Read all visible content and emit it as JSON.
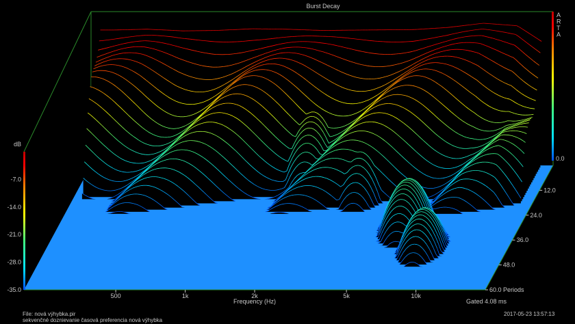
{
  "chart_data": {
    "type": "waterfall-3d",
    "title": "Burst Decay",
    "brand": "ARTA",
    "xlabel": "Frequency (Hz)",
    "x_scale": "log",
    "x_ticks": [
      {
        "value": 500,
        "label": "500"
      },
      {
        "value": 1000,
        "label": "1k"
      },
      {
        "value": 2000,
        "label": "2k"
      },
      {
        "value": 5000,
        "label": "5k"
      },
      {
        "value": 10000,
        "label": "10k"
      }
    ],
    "xlim": [
      200,
      20000
    ],
    "zlabel": "dB",
    "z_ticks": [
      "0.0",
      "-7.0",
      "-14.0",
      "-21.0",
      "-28.0",
      "-35.0"
    ],
    "zlim": [
      -35,
      0
    ],
    "y_ticks": [
      "12.0",
      "24.0",
      "36.0",
      "48.0",
      "60.0 Periods"
    ],
    "ylim": [
      0,
      60
    ],
    "y_unit": "Periods",
    "gated": "Gated 4.08 ms",
    "colormap": [
      "#0050ff",
      "#00e0ff",
      "#40ff80",
      "#ffff00",
      "#ff8000",
      "#ff0000",
      "#c00000"
    ],
    "floor_color": "#1e90ff",
    "slice_count": 60,
    "initial_response_db": [
      [
        250,
        -3.2
      ],
      [
        350,
        -3.0
      ],
      [
        500,
        -3.4
      ],
      [
        700,
        -3.3
      ],
      [
        1000,
        -2.9
      ],
      [
        1400,
        -3.0
      ],
      [
        2000,
        -3.3
      ],
      [
        3000,
        -3.2
      ],
      [
        5000,
        -3.1
      ],
      [
        7000,
        -2.6
      ],
      [
        10000,
        -1.6
      ],
      [
        14000,
        -2.2
      ],
      [
        18000,
        -6.0
      ]
    ],
    "decay_ridges": [
      {
        "freq": 2000,
        "periods": 6,
        "level_db": -18
      },
      {
        "freq": 3500,
        "periods": 12,
        "level_db": -22
      },
      {
        "freq": 6500,
        "periods": 30,
        "level_db": -24
      },
      {
        "freq": 8500,
        "periods": 40,
        "level_db": -26
      }
    ]
  },
  "footer": {
    "file": "File: nová výhybka.pir",
    "note": "sekvenčné doznievanie časová preferencia nová výhybka",
    "timestamp": "2017-05-23  13:57:13"
  }
}
